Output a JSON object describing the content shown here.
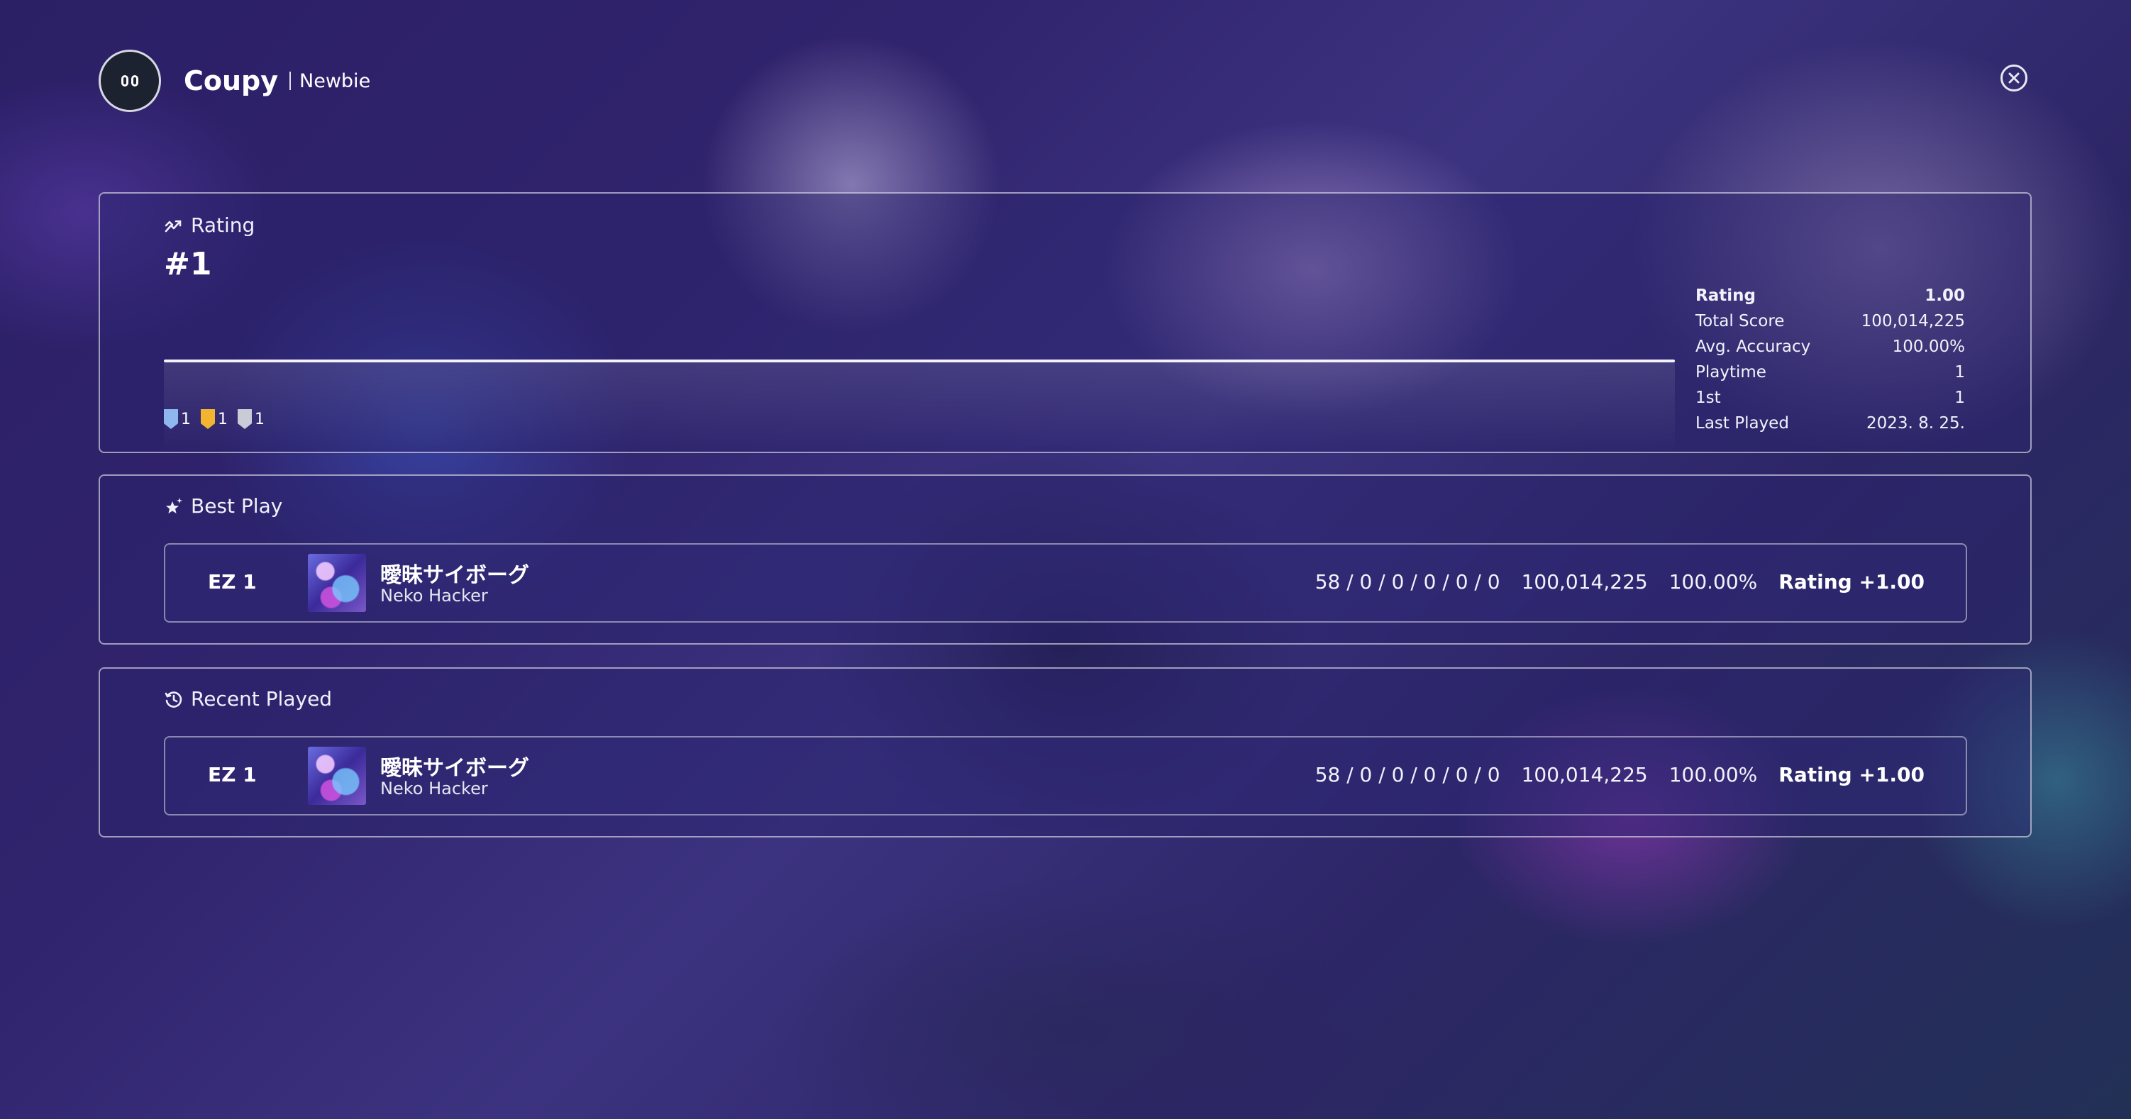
{
  "user": {
    "name": "Coupy",
    "title": "Newbie"
  },
  "rating_panel": {
    "title": "Rating",
    "rank": "#1",
    "medals": [
      {
        "color": "#8fb6ee",
        "count": "1"
      },
      {
        "color": "#f2b531",
        "count": "1"
      },
      {
        "color": "#c9ccd6",
        "count": "1"
      }
    ],
    "stats": [
      {
        "label": "Rating",
        "value": "1.00"
      },
      {
        "label": "Total Score",
        "value": "100,014,225"
      },
      {
        "label": "Avg. Accuracy",
        "value": "100.00%"
      },
      {
        "label": "Playtime",
        "value": "1"
      },
      {
        "label": "1st",
        "value": "1"
      },
      {
        "label": "Last Played",
        "value": "2023. 8. 25."
      }
    ]
  },
  "best_play": {
    "title": "Best Play",
    "entry": {
      "difficulty": "EZ 1",
      "song_title": "曖昧サイボーグ",
      "artist": "Neko Hacker",
      "judgements": "58 / 0 / 0 / 0 / 0 / 0",
      "score": "100,014,225",
      "accuracy": "100.00%",
      "rating": "Rating +1.00"
    }
  },
  "recent_played": {
    "title": "Recent Played",
    "entry": {
      "difficulty": "EZ 1",
      "song_title": "曖昧サイボーグ",
      "artist": "Neko Hacker",
      "judgements": "58 / 0 / 0 / 0 / 0 / 0",
      "score": "100,014,225",
      "accuracy": "100.00%",
      "rating": "Rating +1.00"
    }
  }
}
